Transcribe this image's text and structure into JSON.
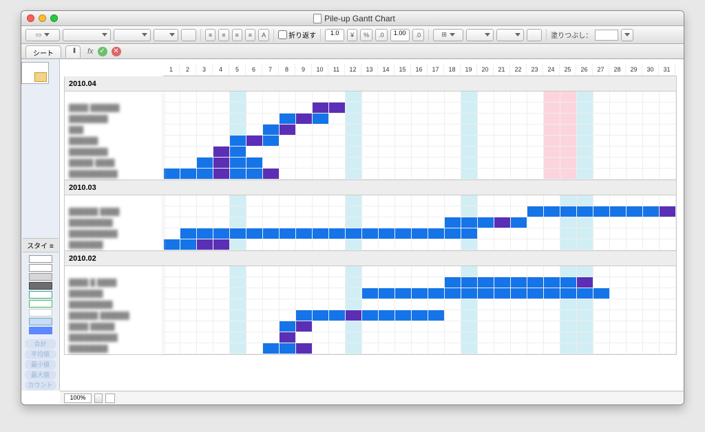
{
  "title": "Pile-up Gantt Chart",
  "tab": "シート",
  "toolbar": {
    "wrap_label": "折り返す",
    "font_size": "1.0",
    "currency": "¥",
    "percent": "%",
    "decimals_a": ".0",
    "num_a": "1.00",
    "decimals_b": ".0",
    "fill_label": "塗りつぶし："
  },
  "side": {
    "style_label": "スタイ",
    "swatches": [
      {
        "bg": "#ffffff",
        "border": "#999"
      },
      {
        "bg": "#ffffff",
        "border": "#999"
      },
      {
        "bg": "#d6d6d6",
        "border": "#999"
      },
      {
        "bg": "#6d6d6d",
        "border": "#444"
      },
      {
        "bg": "#ffffff",
        "border": "#3a8"
      },
      {
        "bg": "#ffffff",
        "border": "#4b5"
      },
      {
        "bg": "#ffffff",
        "border": "#ccc"
      },
      {
        "bg": "#c7dbff",
        "border": "#7aa"
      },
      {
        "bg": "#5e88ff",
        "border": "#5e88ff"
      }
    ],
    "stats": [
      "合計",
      "平均値",
      "最小値",
      "最大値",
      "カウント"
    ]
  },
  "footer": {
    "zoom": "100%"
  },
  "chart_data": {
    "type": "gantt",
    "days": [
      1,
      2,
      3,
      4,
      5,
      6,
      7,
      8,
      9,
      10,
      11,
      12,
      13,
      14,
      15,
      16,
      17,
      18,
      19,
      20,
      21,
      22,
      23,
      24,
      25,
      26,
      27,
      28,
      29,
      30,
      31
    ],
    "weekend_cols": {
      "2010.04": [
        5,
        12,
        19,
        25,
        26
      ],
      "2010.03": [
        5,
        12,
        19,
        25,
        26
      ],
      "2010.02": [
        5,
        12,
        19,
        25,
        26
      ]
    },
    "pink_cols": {
      "2010.04": [
        24,
        25
      ]
    },
    "sections": [
      {
        "label": "2010.04",
        "blank_rows_before": 1,
        "rows": [
          {
            "label": "████ ██████",
            "bars": [
              {
                "start": 10,
                "end": 10,
                "color": "purple"
              },
              {
                "start": 11,
                "end": 11,
                "color": "purple"
              }
            ]
          },
          {
            "label": "████████",
            "bars": [
              {
                "start": 8,
                "end": 9,
                "color": "blue"
              },
              {
                "start": 9,
                "end": 9,
                "color": "purple"
              },
              {
                "start": 10,
                "end": 10,
                "color": "blue"
              }
            ]
          },
          {
            "label": "███",
            "bars": [
              {
                "start": 7,
                "end": 8,
                "color": "blue"
              },
              {
                "start": 8,
                "end": 8,
                "color": "purple"
              }
            ]
          },
          {
            "label": "██████",
            "bars": [
              {
                "start": 5,
                "end": 6,
                "color": "blue"
              },
              {
                "start": 6,
                "end": 6,
                "color": "purple"
              },
              {
                "start": 7,
                "end": 7,
                "color": "blue"
              }
            ]
          },
          {
            "label": "████████",
            "bars": [
              {
                "start": 4,
                "end": 4,
                "color": "purple"
              },
              {
                "start": 5,
                "end": 5,
                "color": "blue"
              }
            ]
          },
          {
            "label": "█████ ████",
            "bars": [
              {
                "start": 3,
                "end": 3,
                "color": "blue"
              },
              {
                "start": 4,
                "end": 4,
                "color": "purple"
              },
              {
                "start": 5,
                "end": 6,
                "color": "blue"
              }
            ]
          },
          {
            "label": "██████████",
            "bars": [
              {
                "start": 1,
                "end": 3,
                "color": "blue"
              },
              {
                "start": 4,
                "end": 4,
                "color": "purple"
              },
              {
                "start": 5,
                "end": 6,
                "color": "blue"
              },
              {
                "start": 7,
                "end": 7,
                "color": "purple"
              }
            ]
          }
        ]
      },
      {
        "label": "2010.03",
        "rows": [
          {
            "label": "██████ ████",
            "bars": [
              {
                "start": 23,
                "end": 30,
                "color": "blue"
              },
              {
                "start": 31,
                "end": 31,
                "color": "purple"
              }
            ]
          },
          {
            "label": "█████████",
            "bars": [
              {
                "start": 18,
                "end": 20,
                "color": "blue"
              },
              {
                "start": 21,
                "end": 21,
                "color": "purple"
              },
              {
                "start": 22,
                "end": 22,
                "color": "blue"
              }
            ]
          },
          {
            "label": "██████████",
            "bars": [
              {
                "start": 2,
                "end": 3,
                "color": "blue"
              },
              {
                "start": 4,
                "end": 19,
                "color": "blue"
              }
            ]
          },
          {
            "label": "███████",
            "bars": [
              {
                "start": 1,
                "end": 2,
                "color": "blue"
              },
              {
                "start": 3,
                "end": 3,
                "color": "purple"
              },
              {
                "start": 4,
                "end": 4,
                "color": "purple"
              }
            ]
          }
        ]
      },
      {
        "label": "2010.02",
        "rows": [
          {
            "label": "████ █ ████",
            "bars": [
              {
                "start": 18,
                "end": 25,
                "color": "blue"
              },
              {
                "start": 26,
                "end": 26,
                "color": "purple"
              }
            ]
          },
          {
            "label": "███████",
            "bars": [
              {
                "start": 13,
                "end": 27,
                "color": "blue"
              }
            ]
          },
          {
            "label": "█████████",
            "bars": []
          },
          {
            "label": "██████ ██████",
            "bars": [
              {
                "start": 9,
                "end": 11,
                "color": "blue"
              },
              {
                "start": 12,
                "end": 12,
                "color": "purple"
              },
              {
                "start": 13,
                "end": 17,
                "color": "blue"
              }
            ]
          },
          {
            "label": "████ █████",
            "bars": [
              {
                "start": 8,
                "end": 8,
                "color": "blue"
              },
              {
                "start": 9,
                "end": 9,
                "color": "purple"
              }
            ]
          },
          {
            "label": "██████████",
            "bars": [
              {
                "start": 8,
                "end": 8,
                "color": "purple"
              }
            ]
          },
          {
            "label": "████████",
            "bars": [
              {
                "start": 7,
                "end": 8,
                "color": "blue"
              },
              {
                "start": 9,
                "end": 9,
                "color": "purple"
              }
            ]
          }
        ]
      }
    ]
  }
}
